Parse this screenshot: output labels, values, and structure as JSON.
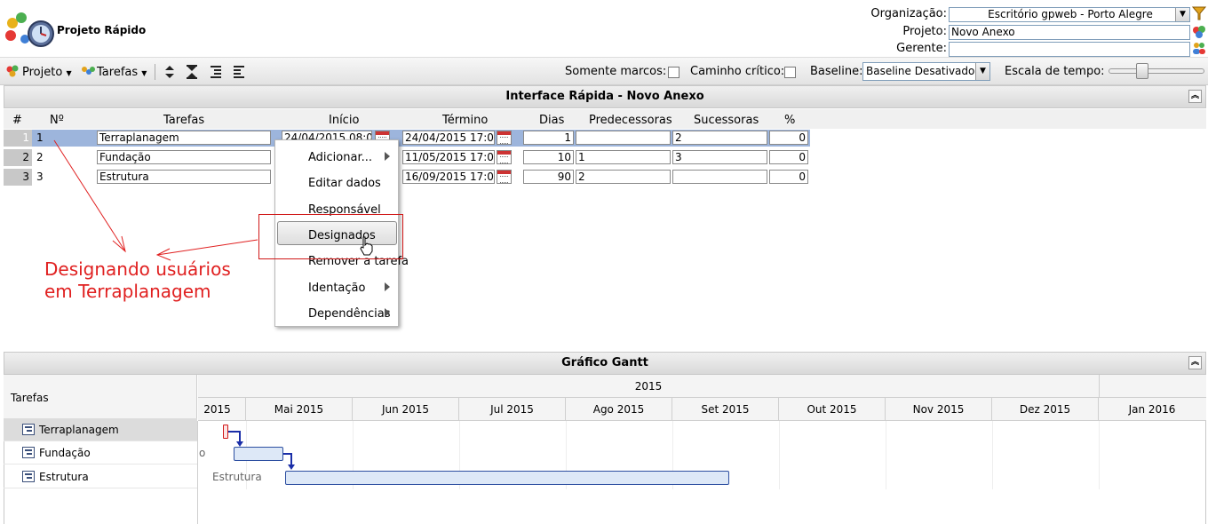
{
  "app": {
    "title": "Projeto Rápido"
  },
  "header": {
    "organizacao_label": "Organização:",
    "organizacao_value": "Escritório gpweb - Porto Alegre",
    "projeto_label": "Projeto:",
    "projeto_value": "Novo Anexo",
    "gerente_label": "Gerente:",
    "gerente_value": ""
  },
  "toolbar": {
    "projeto_label": "Projeto",
    "tarefas_label": "Tarefas",
    "somente_marcos_label": "Somente marcos:",
    "caminho_critico_label": "Caminho crítico:",
    "baseline_label": "Baseline:",
    "baseline_value": "Baseline Desativado",
    "escala_label": "Escala de tempo:"
  },
  "interface_panel": {
    "title": "Interface Rápida - Novo Anexo",
    "columns": [
      "#",
      "Nº",
      "Tarefas",
      "Início",
      "Término",
      "Dias",
      "Predecessoras",
      "Sucessoras",
      "%"
    ],
    "rows": [
      {
        "idx": "1",
        "num": "1",
        "tarefa": "Terraplanagem",
        "inicio": "24/04/2015 08:00",
        "termino": "24/04/2015 17:00",
        "dias": "1",
        "pred": "",
        "suc": "2",
        "pct": "0"
      },
      {
        "idx": "2",
        "num": "2",
        "tarefa": "Fundação",
        "inicio": "",
        "termino": "11/05/2015 17:00",
        "dias": "10",
        "pred": "1",
        "suc": "3",
        "pct": "0"
      },
      {
        "idx": "3",
        "num": "3",
        "tarefa": "Estrutura",
        "inicio": "",
        "termino": "16/09/2015 17:00",
        "dias": "90",
        "pred": "2",
        "suc": "",
        "pct": "0"
      }
    ]
  },
  "context_menu": {
    "items": [
      "Adicionar...",
      "Editar dados",
      "Responsável",
      "Designados",
      "Remover a tarefa",
      "Identação",
      "Dependências"
    ]
  },
  "annotation": {
    "line1": "Designando usuários",
    "line2": "em Terraplanagem",
    "color": "#e02020"
  },
  "gantt": {
    "title": "Gráfico Gantt",
    "tasks_header": "Tarefas",
    "year": "2015",
    "months": [
      "2015",
      "Mai 2015",
      "Jun 2015",
      "Jul 2015",
      "Ago 2015",
      "Set 2015",
      "Out 2015",
      "Nov 2015",
      "Dez 2015",
      "Jan 2016"
    ],
    "tasks": [
      "Terraplanagem",
      "Fundação",
      "Estrutura"
    ],
    "bar_labels": {
      "fundacao_partial": "o",
      "estrutura": "Estrutura"
    }
  }
}
